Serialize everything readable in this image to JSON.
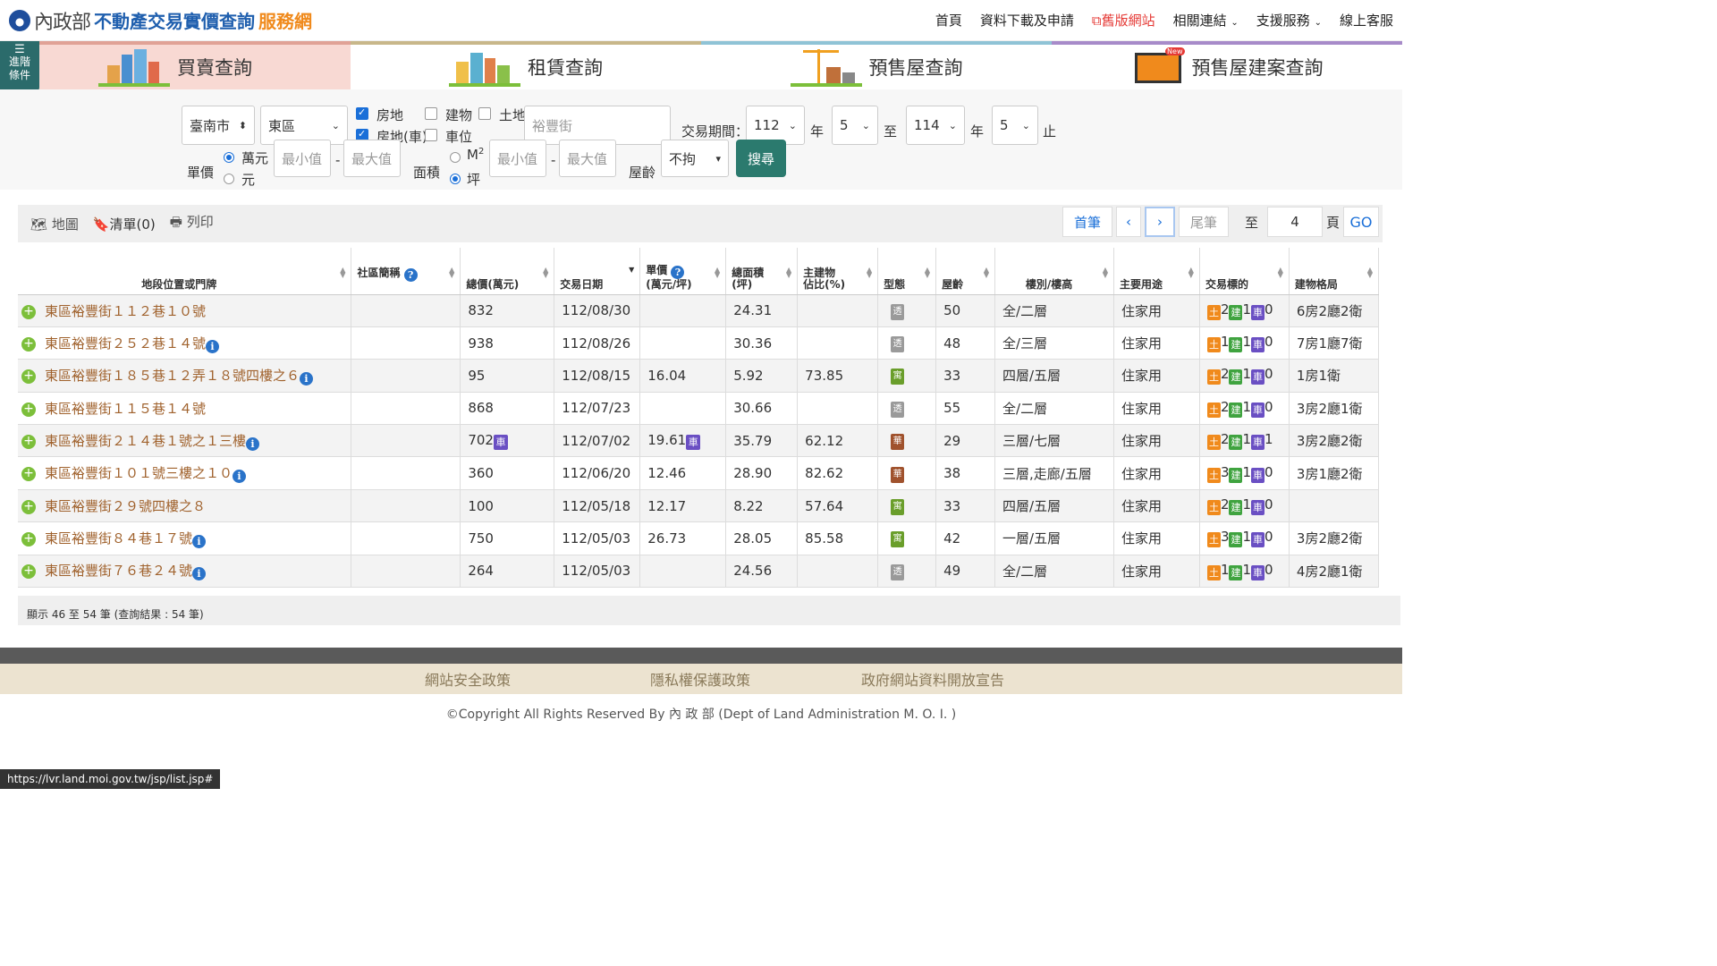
{
  "header": {
    "ministry": "內政部",
    "title_main": "不動產交易實價查詢",
    "title_sub": "服務網",
    "nav": [
      "首頁",
      "資料下載及申請",
      "舊版網站",
      "相關連結",
      "支援服務",
      "線上客服"
    ]
  },
  "advanced": {
    "line1": "進階",
    "line2": "條件"
  },
  "tabs": [
    "買賣查詢",
    "租賃查詢",
    "預售屋查詢",
    "預售屋建案查詢"
  ],
  "tab_badge": "New",
  "search": {
    "city": "臺南市",
    "district": "東區",
    "types": {
      "house_land": "房地",
      "building": "建物",
      "land": "土地",
      "house_land_car": "房地(車)",
      "parking": "車位"
    },
    "road": "裕豐街",
    "period_label": "交易期間：",
    "year_from": "112",
    "month_from": "5",
    "year_to": "114",
    "month_to": "5",
    "year_unit": "年",
    "to": "至",
    "end": "止",
    "unit_price_label": "單價",
    "unit_wan": "萬元",
    "unit_yuan": "元",
    "min": "最小值",
    "max": "最大值",
    "area_label": "面積",
    "area_m2": "M",
    "area_m2_sup": "2",
    "area_ping": "坪",
    "age_label": "屋齡",
    "age_value": "不拘",
    "search_btn": "搜尋",
    "dash": "-"
  },
  "toolbar": {
    "map": "地圖",
    "list": "清單(0)",
    "print": "列印",
    "first": "首筆",
    "prev": "‹",
    "next": "›",
    "last": "尾筆",
    "goto_label": "至",
    "goto_value": "4",
    "page_unit": "頁",
    "go": "GO"
  },
  "table": {
    "headers": [
      "地段位置或門牌",
      "社區簡稱",
      "總價(萬元)",
      "交易日期",
      "單價",
      "(萬元/坪)",
      "總面積",
      "(坪)",
      "主建物",
      "佔比(%)",
      "型態",
      "屋齡",
      "樓別/樓高",
      "主要用途",
      "交易標的",
      "建物格局"
    ],
    "tag_labels": {
      "land": "土",
      "build": "建",
      "car": "車"
    },
    "rows": [
      {
        "loc": "東區裕豐街１１２巷１０號",
        "info": false,
        "total": "832",
        "totalCar": false,
        "date": "112/08/30",
        "unit": "",
        "unitCar": false,
        "area": "24.31",
        "ratio": "",
        "type": "透",
        "tc": "grey",
        "age": "50",
        "floor": "全/二層",
        "use": "住家用",
        "t": [
          "2",
          "1",
          "0"
        ],
        "layout": "6房2廳2衛"
      },
      {
        "loc": "東區裕豐街２５２巷１４號",
        "info": true,
        "total": "938",
        "totalCar": false,
        "date": "112/08/26",
        "unit": "",
        "unitCar": false,
        "area": "30.36",
        "ratio": "",
        "type": "透",
        "tc": "grey",
        "age": "48",
        "floor": "全/三層",
        "use": "住家用",
        "t": [
          "1",
          "1",
          "0"
        ],
        "layout": "7房1廳7衛"
      },
      {
        "loc": "東區裕豐街１８５巷１２弄１８號四樓之６",
        "info": true,
        "total": "95",
        "totalCar": false,
        "date": "112/08/15",
        "unit": "16.04",
        "unitCar": false,
        "area": "5.92",
        "ratio": "73.85",
        "type": "寓",
        "tc": "green",
        "age": "33",
        "floor": "四層/五層",
        "use": "住家用",
        "t": [
          "2",
          "1",
          "0"
        ],
        "layout": "1房1衛"
      },
      {
        "loc": "東區裕豐街１１５巷１４號",
        "info": false,
        "total": "868",
        "totalCar": false,
        "date": "112/07/23",
        "unit": "",
        "unitCar": false,
        "area": "30.66",
        "ratio": "",
        "type": "透",
        "tc": "grey",
        "age": "55",
        "floor": "全/二層",
        "use": "住家用",
        "t": [
          "2",
          "1",
          "0"
        ],
        "layout": "3房2廳1衛"
      },
      {
        "loc": "東區裕豐街２１４巷１號之１三樓",
        "info": true,
        "total": "702",
        "totalCar": true,
        "date": "112/07/02",
        "unit": "19.61",
        "unitCar": true,
        "area": "35.79",
        "ratio": "62.12",
        "type": "華",
        "tc": "brown",
        "age": "29",
        "floor": "三層/七層",
        "use": "住家用",
        "t": [
          "2",
          "1",
          "1"
        ],
        "layout": "3房2廳2衛"
      },
      {
        "loc": "東區裕豐街１０１號三樓之１０",
        "info": true,
        "total": "360",
        "totalCar": false,
        "date": "112/06/20",
        "unit": "12.46",
        "unitCar": false,
        "area": "28.90",
        "ratio": "82.62",
        "type": "華",
        "tc": "brown",
        "age": "38",
        "floor": "三層,走廊/五層",
        "use": "住家用",
        "t": [
          "3",
          "1",
          "0"
        ],
        "layout": "3房1廳2衛"
      },
      {
        "loc": "東區裕豐街２９號四樓之８",
        "info": false,
        "total": "100",
        "totalCar": false,
        "date": "112/05/18",
        "unit": "12.17",
        "unitCar": false,
        "area": "8.22",
        "ratio": "57.64",
        "type": "寓",
        "tc": "green",
        "age": "33",
        "floor": "四層/五層",
        "use": "住家用",
        "t": [
          "2",
          "1",
          "0"
        ],
        "layout": ""
      },
      {
        "loc": "東區裕豐街８４巷１７號",
        "info": true,
        "total": "750",
        "totalCar": false,
        "date": "112/05/03",
        "unit": "26.73",
        "unitCar": false,
        "area": "28.05",
        "ratio": "85.58",
        "type": "寓",
        "tc": "green",
        "age": "42",
        "floor": "一層/五層",
        "use": "住家用",
        "t": [
          "3",
          "1",
          "0"
        ],
        "layout": "3房2廳2衛"
      },
      {
        "loc": "東區裕豐街７６巷２４號",
        "info": true,
        "total": "264",
        "totalCar": false,
        "date": "112/05/03",
        "unit": "",
        "unitCar": false,
        "area": "24.56",
        "ratio": "",
        "type": "透",
        "tc": "grey",
        "age": "49",
        "floor": "全/二層",
        "use": "住家用",
        "t": [
          "1",
          "1",
          "0"
        ],
        "layout": "4房2廳1衛"
      }
    ]
  },
  "summary": "顯示 46 至 54 筆 (查詢結果 : 54 筆)",
  "footer": {
    "links": [
      "網站安全政策",
      "隱私權保護政策",
      "政府網站資料開放宣告"
    ],
    "copyright": "©Copyright All Rights Reserved By 內 政 部 (Dept of Land Administration M. O. I. )"
  },
  "status_url": "https://lvr.land.moi.gov.tw/jsp/list.jsp#"
}
